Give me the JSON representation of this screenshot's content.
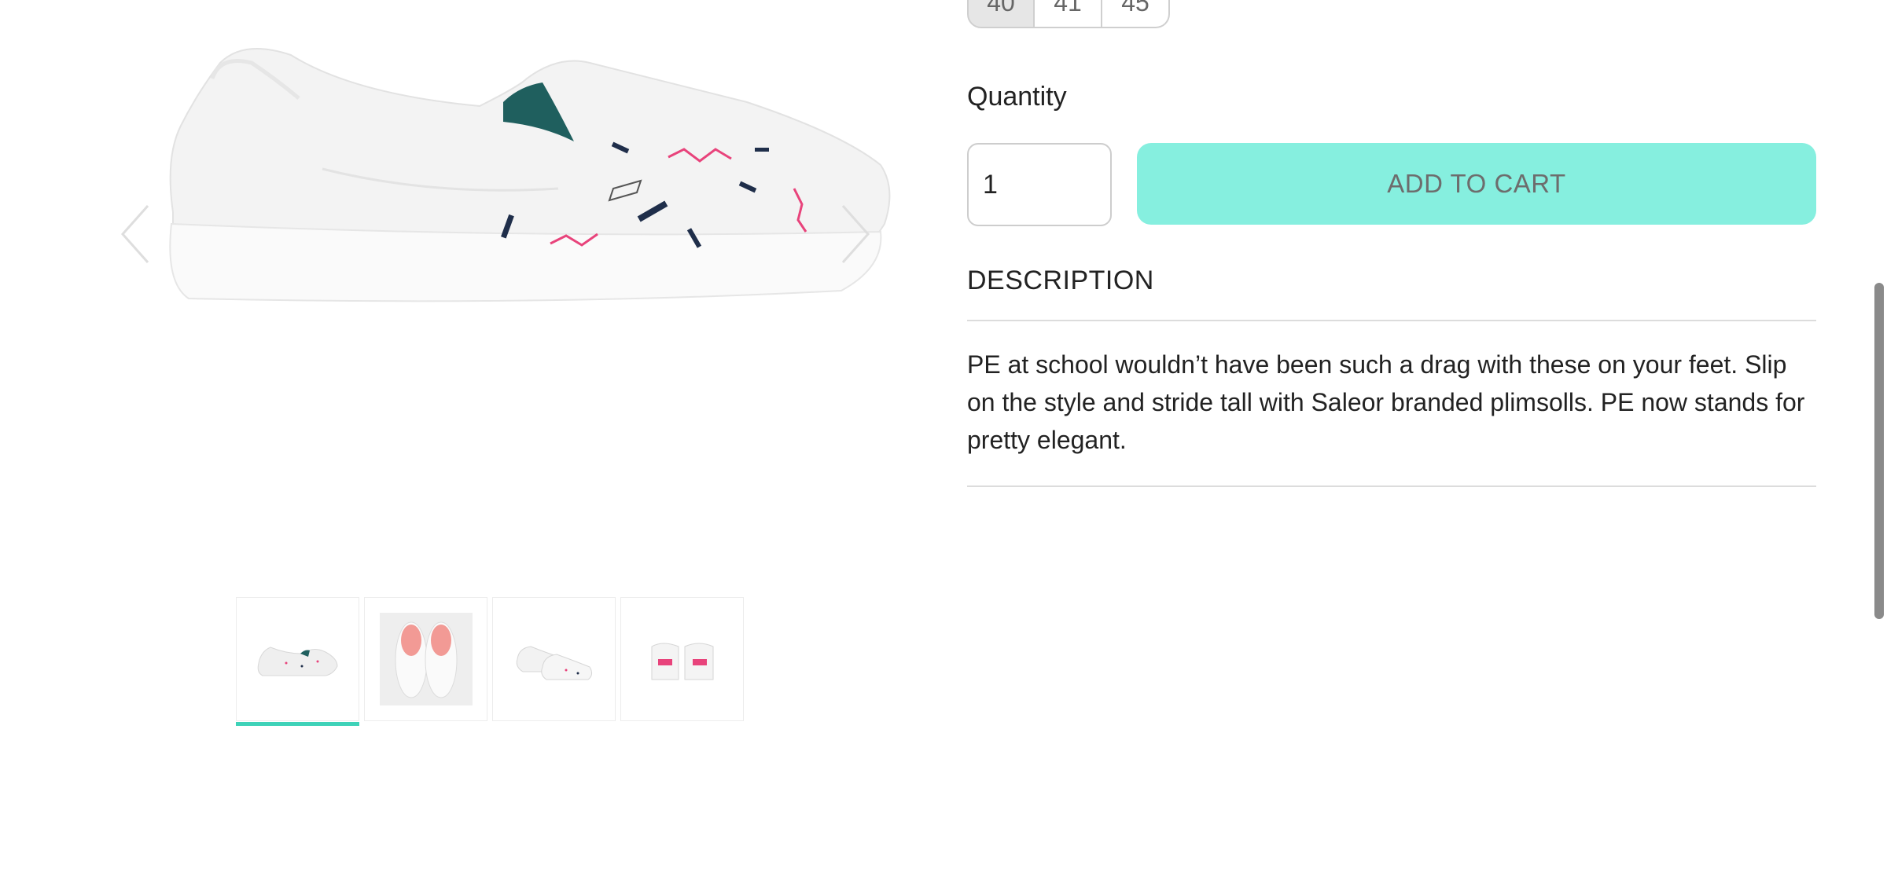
{
  "product": {
    "sizes": [
      {
        "label": "40",
        "selected": true
      },
      {
        "label": "41",
        "selected": false
      },
      {
        "label": "45",
        "selected": false
      }
    ],
    "quantity_label": "Quantity",
    "quantity_value": "1",
    "add_to_cart_label": "ADD TO CART",
    "description_title": "DESCRIPTION",
    "description_text": "PE at school wouldn’t have been such a drag with these on your feet. Slip on the style and stride tall with Saleor branded plimsolls. PE now stands for pretty elegant."
  },
  "gallery": {
    "main_image_icon": "slip-on-shoe-side-view-image",
    "thumbnails": [
      {
        "icon": "shoe-side-thumbnail",
        "active": true
      },
      {
        "icon": "shoe-top-pair-thumbnail",
        "active": false
      },
      {
        "icon": "shoe-pair-angle-thumbnail",
        "active": false
      },
      {
        "icon": "shoe-heels-thumbnail",
        "active": false
      }
    ]
  },
  "colors": {
    "accent": "#3ed2b8",
    "cart_button": "#86efdf",
    "shoe_pink": "#e8437b",
    "shoe_teal_lining": "#1f5f5e"
  }
}
